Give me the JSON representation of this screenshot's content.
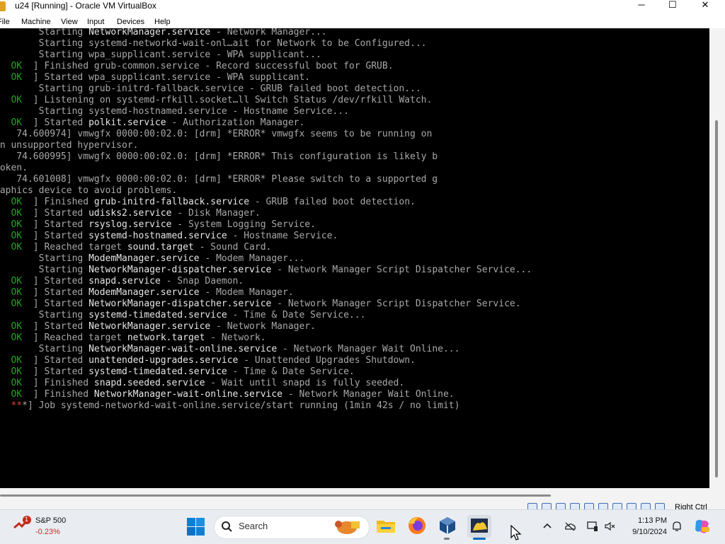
{
  "window": {
    "title": "u24 [Running] - Oracle VM VirtualBox",
    "controls": {
      "minimize": "─",
      "maximize": "☐",
      "close": "✕"
    }
  },
  "menu": [
    "File",
    "Machine",
    "View",
    "Input",
    "Devices",
    "Help"
  ],
  "console": {
    "lines": [
      [
        {
          "t": "        Starting "
        },
        {
          "t": "NetworkManager.service",
          "c": "hl"
        },
        {
          "t": " - Network Manager..."
        }
      ],
      [
        {
          "t": "        Starting systemd-networkd-wait-onl…ait for Network to be Configured..."
        }
      ],
      [
        {
          "t": "        Starting wpa_supplicant.service - WPA supplicant..."
        }
      ],
      [
        {
          "t": "[  "
        },
        {
          "t": "OK",
          "c": "ok"
        },
        {
          "t": "  ] Finished grub-common.service - Record successful boot for GRUB."
        }
      ],
      [
        {
          "t": "[  "
        },
        {
          "t": "OK",
          "c": "ok"
        },
        {
          "t": "  ] Started wpa_supplicant.service - WPA supplicant."
        }
      ],
      [
        {
          "t": "        Starting grub-initrd-fallback.service - GRUB failed boot detection..."
        }
      ],
      [
        {
          "t": "[  "
        },
        {
          "t": "OK",
          "c": "ok"
        },
        {
          "t": "  ] Listening on systemd-rfkill.socket…ll Switch Status /dev/rfkill Watch."
        }
      ],
      [
        {
          "t": "        Starting systemd-hostnamed.service - Hostname Service..."
        }
      ],
      [
        {
          "t": "[  "
        },
        {
          "t": "OK",
          "c": "ok"
        },
        {
          "t": "  ] Started "
        },
        {
          "t": "polkit.service",
          "c": "hl"
        },
        {
          "t": " - Authorization Manager."
        }
      ],
      [
        {
          "t": "[   74.600974] vmwgfx 0000:00:02.0: [drm] *ERROR* vmwgfx seems to be running on"
        }
      ],
      [
        {
          "t": "an unsupported hypervisor."
        }
      ],
      [
        {
          "t": "[   74.600995] vmwgfx 0000:00:02.0: [drm] *ERROR* This configuration is likely b"
        }
      ],
      [
        {
          "t": "roken."
        }
      ],
      [
        {
          "t": "[   74.601008] vmwgfx 0000:00:02.0: [drm] *ERROR* Please switch to a supported g"
        }
      ],
      [
        {
          "t": "raphics device to avoid problems."
        }
      ],
      [
        {
          "t": "[  "
        },
        {
          "t": "OK",
          "c": "ok"
        },
        {
          "t": "  ] Finished "
        },
        {
          "t": "grub-initrd-fallback.service",
          "c": "hl"
        },
        {
          "t": " - GRUB failed boot detection."
        }
      ],
      [
        {
          "t": "[  "
        },
        {
          "t": "OK",
          "c": "ok"
        },
        {
          "t": "  ] Started "
        },
        {
          "t": "udisks2.service",
          "c": "hl"
        },
        {
          "t": " - Disk Manager."
        }
      ],
      [
        {
          "t": "[  "
        },
        {
          "t": "OK",
          "c": "ok"
        },
        {
          "t": "  ] Started "
        },
        {
          "t": "rsyslog.service",
          "c": "hl"
        },
        {
          "t": " - System Logging Service."
        }
      ],
      [
        {
          "t": "[  "
        },
        {
          "t": "OK",
          "c": "ok"
        },
        {
          "t": "  ] Started "
        },
        {
          "t": "systemd-hostnamed.service",
          "c": "hl"
        },
        {
          "t": " - Hostname Service."
        }
      ],
      [
        {
          "t": "[  "
        },
        {
          "t": "OK",
          "c": "ok"
        },
        {
          "t": "  ] Reached target "
        },
        {
          "t": "sound.target",
          "c": "hl"
        },
        {
          "t": " - Sound Card."
        }
      ],
      [
        {
          "t": "        Starting "
        },
        {
          "t": "ModemManager.service",
          "c": "hl"
        },
        {
          "t": " - Modem Manager..."
        }
      ],
      [
        {
          "t": "        Starting "
        },
        {
          "t": "NetworkManager-dispatcher.service",
          "c": "hl"
        },
        {
          "t": " - Network Manager Script Dispatcher Service..."
        }
      ],
      [
        {
          "t": "[  "
        },
        {
          "t": "OK",
          "c": "ok"
        },
        {
          "t": "  ] Started "
        },
        {
          "t": "snapd.service",
          "c": "hl"
        },
        {
          "t": " - Snap Daemon."
        }
      ],
      [
        {
          "t": "[  "
        },
        {
          "t": "OK",
          "c": "ok"
        },
        {
          "t": "  ] Started "
        },
        {
          "t": "ModemManager.service",
          "c": "hl"
        },
        {
          "t": " - Modem Manager."
        }
      ],
      [
        {
          "t": "[  "
        },
        {
          "t": "OK",
          "c": "ok"
        },
        {
          "t": "  ] Started "
        },
        {
          "t": "NetworkManager-dispatcher.service",
          "c": "hl"
        },
        {
          "t": " - Network Manager Script Dispatcher Service."
        }
      ],
      [
        {
          "t": "        Starting "
        },
        {
          "t": "systemd-timedated.service",
          "c": "hl"
        },
        {
          "t": " - Time & Date Service..."
        }
      ],
      [
        {
          "t": "[  "
        },
        {
          "t": "OK",
          "c": "ok"
        },
        {
          "t": "  ] Started "
        },
        {
          "t": "NetworkManager.service",
          "c": "hl"
        },
        {
          "t": " - Network Manager."
        }
      ],
      [
        {
          "t": "[  "
        },
        {
          "t": "OK",
          "c": "ok"
        },
        {
          "t": "  ] Reached target "
        },
        {
          "t": "network.target",
          "c": "hl"
        },
        {
          "t": " - Network."
        }
      ],
      [
        {
          "t": "        Starting "
        },
        {
          "t": "NetworkManager-wait-online.service",
          "c": "hl"
        },
        {
          "t": " - Network Manager Wait Online..."
        }
      ],
      [
        {
          "t": "[  "
        },
        {
          "t": "OK",
          "c": "ok"
        },
        {
          "t": "  ] Started "
        },
        {
          "t": "unattended-upgrades.service",
          "c": "hl"
        },
        {
          "t": " - Unattended Upgrades Shutdown."
        }
      ],
      [
        {
          "t": "[  "
        },
        {
          "t": "OK",
          "c": "ok"
        },
        {
          "t": "  ] Started "
        },
        {
          "t": "systemd-timedated.service",
          "c": "hl"
        },
        {
          "t": " - Time & Date Service."
        }
      ],
      [
        {
          "t": "[  "
        },
        {
          "t": "OK",
          "c": "ok"
        },
        {
          "t": "  ] Finished "
        },
        {
          "t": "snapd.seeded.service",
          "c": "hl"
        },
        {
          "t": " - Wait until snapd is fully seeded."
        }
      ],
      [
        {
          "t": "[  "
        },
        {
          "t": "OK",
          "c": "ok"
        },
        {
          "t": "  ] Finished "
        },
        {
          "t": "NetworkManager-wait-online.service",
          "c": "hl"
        },
        {
          "t": " - Network Manager Wait Online."
        }
      ],
      [
        {
          "t": "[  "
        },
        {
          "t": "**",
          "c": "st"
        },
        {
          "t": "*] Job systemd-networkd-wait-online.service/start running (1min 42s / no limit)"
        }
      ]
    ]
  },
  "statusbar": {
    "host_key": "Right Ctrl"
  },
  "taskbar": {
    "widget": {
      "name": "S&P 500",
      "change": "-0.23%",
      "badge": "1"
    },
    "search_placeholder": "Search",
    "apps": [
      "start-icon",
      "file-explorer-icon",
      "firefox-icon",
      "virtualbox-icon",
      "virtualbox-vm-icon"
    ],
    "clock": {
      "time": "1:13 PM",
      "date": "9/10/2024"
    }
  },
  "colors": {
    "ok": "#1ea81e",
    "console_bg": "#000000",
    "console_text": "#a8a8a8",
    "accent": "#0067c0"
  }
}
